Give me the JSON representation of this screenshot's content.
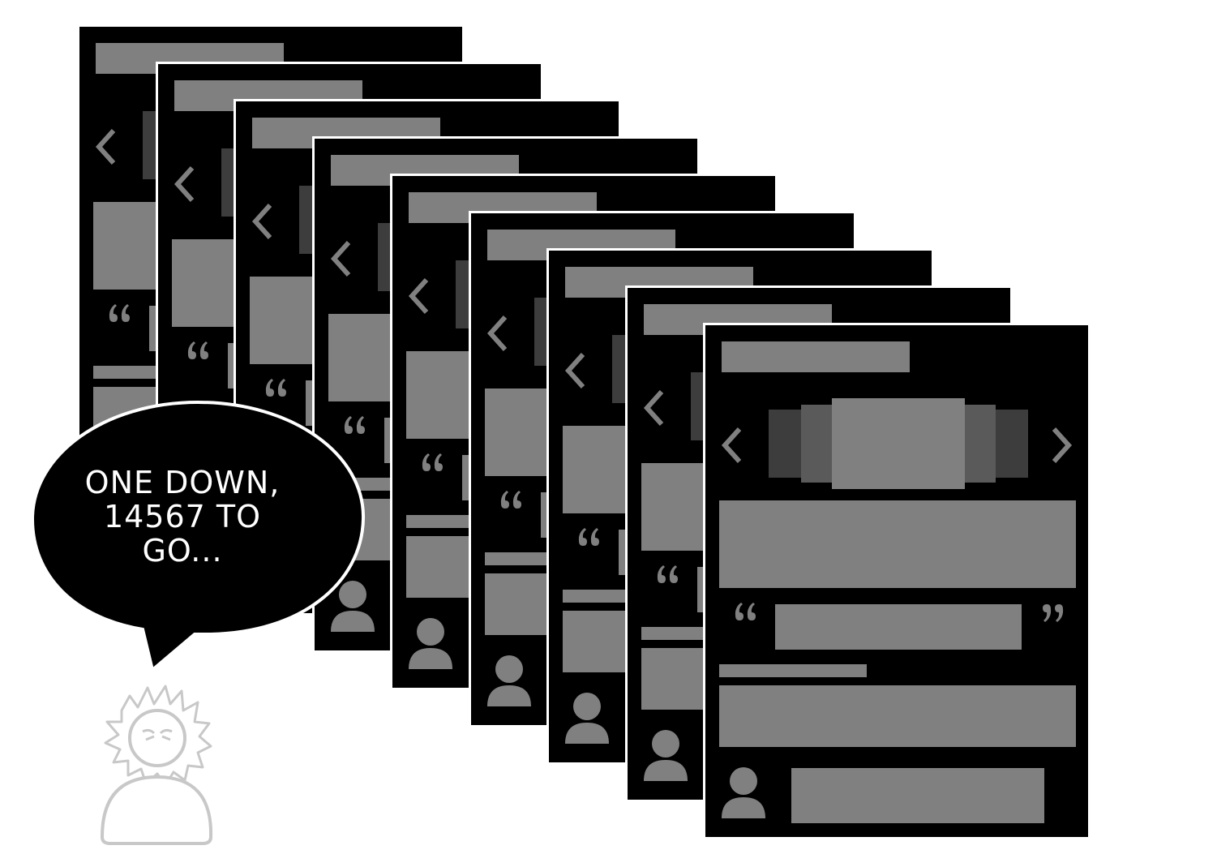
{
  "speech_bubble": {
    "text_line1": "ONE DOWN,",
    "text_line2": "14567 TO",
    "text_line3": "GO..."
  },
  "cards": {
    "count": 9
  },
  "icons": {
    "prev": "chevron-left-icon",
    "next": "chevron-right-icon",
    "quote_open": "quote-open-icon",
    "quote_close": "quote-close-icon",
    "avatar": "user-avatar-icon",
    "character": "frustrated-person-icon"
  },
  "colors": {
    "card": "#000000",
    "placeholder": "#808080",
    "dim": "#3d3d3d",
    "mid": "#5a5a5a"
  }
}
